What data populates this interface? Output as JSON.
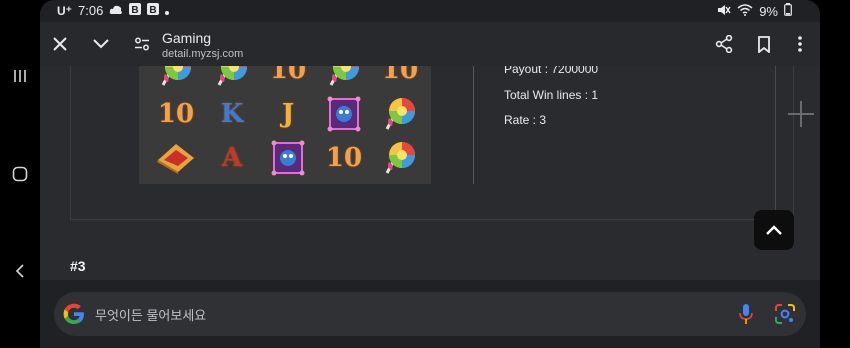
{
  "status_bar": {
    "time": "7:06",
    "carrier_icon": "U⁺",
    "icons_left": [
      "cloud-icon",
      "b-badge-icon",
      "b-badge-icon",
      "dot-icon"
    ],
    "icons_right": [
      "mute-icon",
      "wifi-icon",
      "battery-icon"
    ],
    "battery": "9%"
  },
  "toolbar": {
    "title": "Gaming",
    "url": "detail.myzsj.com"
  },
  "result": {
    "payout": "Payout : 7200000",
    "total_win_lines": "Total Win lines : 1",
    "rate": "Rate : 3"
  },
  "symbols": [
    [
      "lollipop-icon",
      "lollipop-icon",
      "10",
      "lollipop-icon",
      "10"
    ],
    [
      "10",
      "K",
      "J",
      "gem-box-icon",
      "lollipop-icon"
    ],
    [
      "candy-bar-icon",
      "A",
      "gem-box-icon",
      "10",
      "lollipop-icon"
    ]
  ],
  "section_heading": "#3",
  "search": {
    "placeholder": "무엇이든 물어보세요"
  },
  "colors": {
    "background": "#202124",
    "toolbar": "#28292c",
    "content": "#2a2b2e",
    "reel": "#3a3a3a",
    "symbol_orange": "#f2a24a",
    "symbol_blue": "#3a7bd5"
  }
}
